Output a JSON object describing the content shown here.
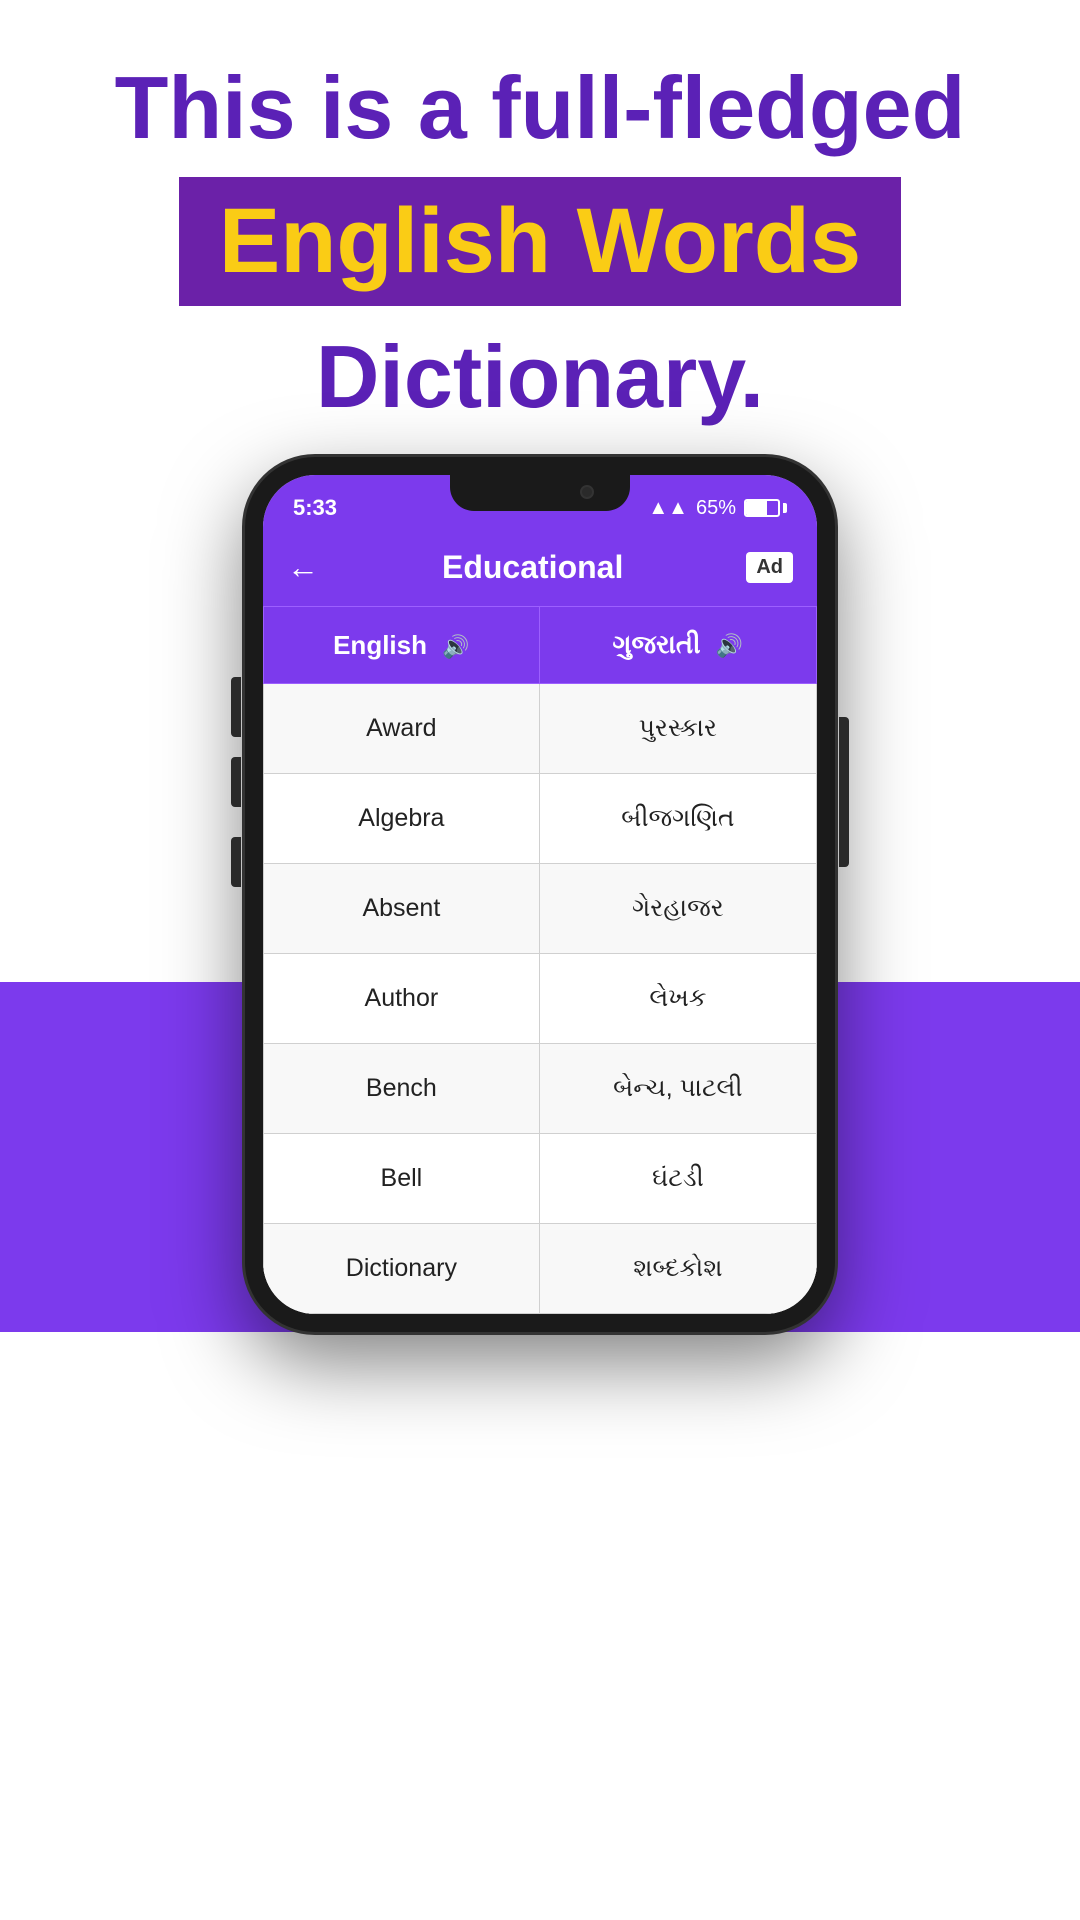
{
  "hero": {
    "line1": "This is a full-fledged",
    "highlight": "English Words",
    "line3": "Dictionary."
  },
  "phone": {
    "status": {
      "time": "5:33",
      "signal": "▲▲",
      "battery_percent": "65%"
    },
    "app_bar": {
      "back_icon": "←",
      "title": "Educational",
      "ad_label": "Ad"
    },
    "table": {
      "col1_header": "English",
      "col2_header": "ગુજરાતી",
      "rows": [
        {
          "english": "Award",
          "gujarati": "પુરસ્કાર"
        },
        {
          "english": "Algebra",
          "gujarati": "બીજગણિત"
        },
        {
          "english": "Absent",
          "gujarati": "ગેરહાજર"
        },
        {
          "english": "Author",
          "gujarati": "લેખક"
        },
        {
          "english": "Bench",
          "gujarati": "બેન્ચ, પાટલી"
        },
        {
          "english": "Bell",
          "gujarati": "ઘંટડી"
        },
        {
          "english": "Dictionary",
          "gujarati": "શબ્દકોશ"
        }
      ]
    }
  }
}
